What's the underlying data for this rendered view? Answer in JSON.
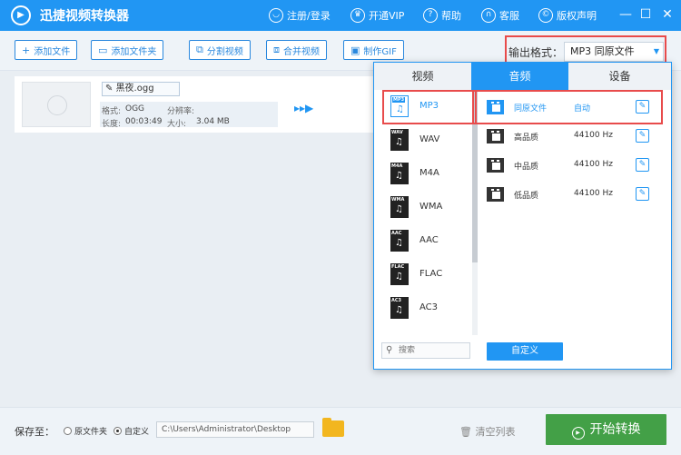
{
  "titlebar": {
    "title": "迅捷视频转换器",
    "items": [
      "注册/登录",
      "开通VIP",
      "帮助",
      "客服",
      "版权声明"
    ],
    "win": [
      "—",
      "☐",
      "✕"
    ]
  },
  "toolbar": {
    "buttons": [
      "添加文件",
      "添加文件夹",
      "分割视频",
      "合并视频",
      "制作GIF"
    ],
    "output_label": "输出格式：",
    "output_value": "MP3  同原文件"
  },
  "file": {
    "name": "黑夜.ogg",
    "format_k": "格式:",
    "format_v": "OGG",
    "res_k": "分辨率:",
    "len_k": "长度:",
    "len_v": "00:03:49",
    "size_k": "大小:",
    "size_v": "3.04 MB"
  },
  "dialog": {
    "tabs": [
      "视频",
      "音频",
      "设备"
    ],
    "formats": [
      {
        "tag": "MP3",
        "name": "MP3"
      },
      {
        "tag": "WAV",
        "name": "WAV"
      },
      {
        "tag": "M4A",
        "name": "M4A"
      },
      {
        "tag": "WMA",
        "name": "WMA"
      },
      {
        "tag": "AAC",
        "name": "AAC"
      },
      {
        "tag": "FLAC",
        "name": "FLAC"
      },
      {
        "tag": "AC3",
        "name": "AC3"
      }
    ],
    "qualities": [
      {
        "name": "同原文件",
        "rate": "自动"
      },
      {
        "name": "高品质",
        "rate": "44100 Hz"
      },
      {
        "name": "中品质",
        "rate": "44100 Hz"
      },
      {
        "name": "低品质",
        "rate": "44100 Hz"
      }
    ],
    "search_placeholder": "搜索",
    "custom_label": "自定义"
  },
  "bottom": {
    "save_label": "保存至：",
    "opt_source": "原文件夹",
    "opt_custom": "自定义",
    "path": "C:\\Users\\Administrator\\Desktop",
    "clear_label": "清空列表",
    "start_label": "开始转换"
  },
  "colors": {
    "primary": "#2196f3",
    "highlight": "#e84b4b",
    "start": "#43a047"
  }
}
